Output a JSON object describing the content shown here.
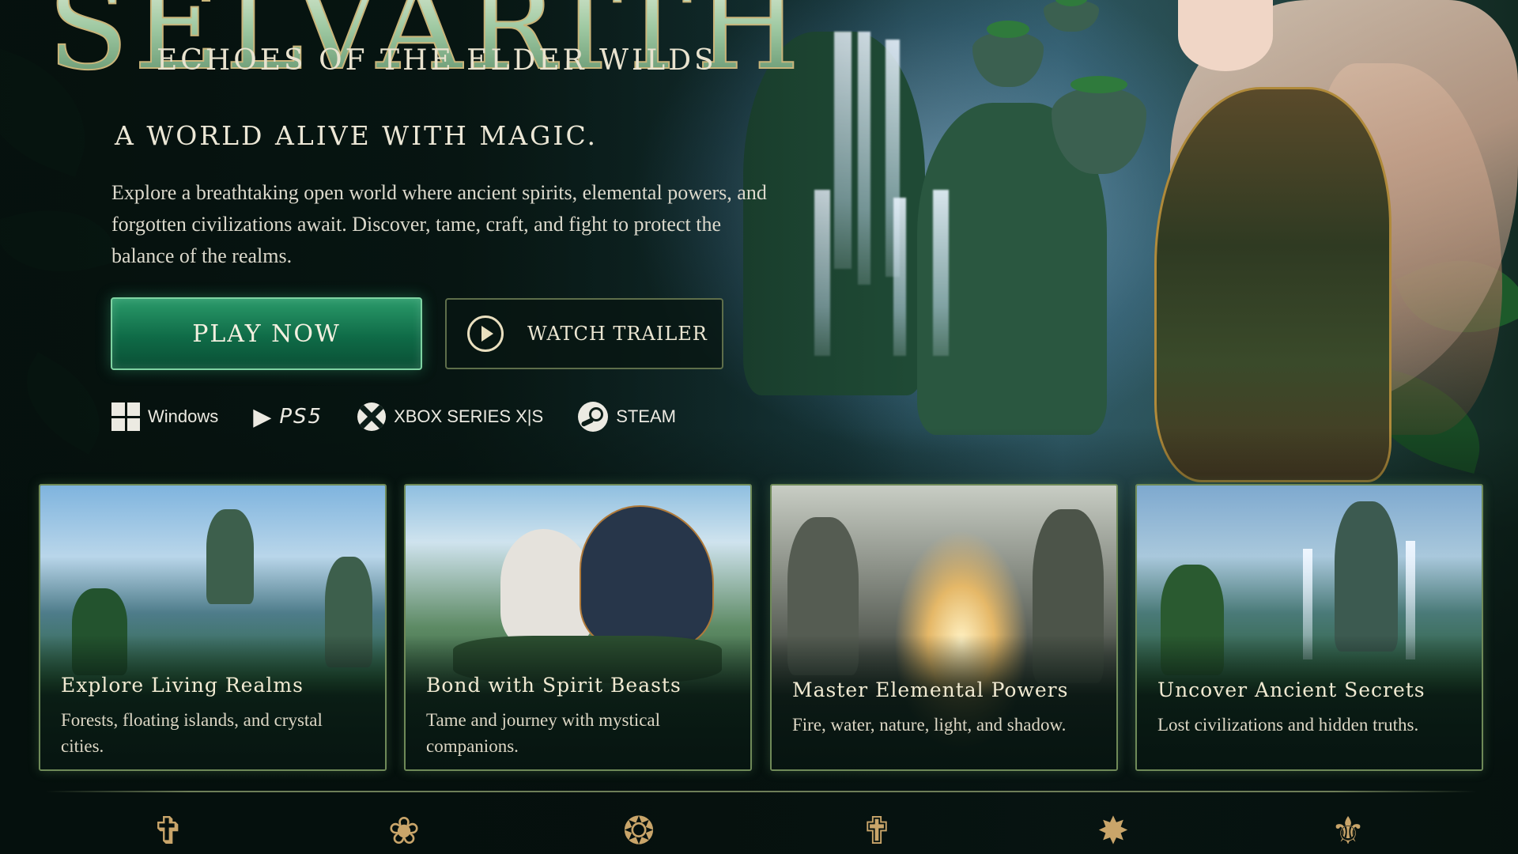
{
  "hero": {
    "logo_text": "SELVARITH",
    "subtitle": "ECHOES OF THE ELDER WILDS",
    "tagline": "A  WORLD ALIVE WITH MAGIC.",
    "description": "Explore a breathtaking open world where ancient spirits, elemental powers, and forgotten civilizations await. Discover, tame, craft, and fight to protect the balance of the realms."
  },
  "buttons": {
    "play_label": "PLAY NOW",
    "trailer_label": "WATCH TRAILER"
  },
  "platforms": {
    "windows": "Windows",
    "ps5": "PS5",
    "xbox": "XBOX SERIES X|S",
    "steam": "STEAM"
  },
  "cards": [
    {
      "title": "Explore Living Realms",
      "desc": "Forests, floating islands, and crystal cities."
    },
    {
      "title": "Bond with Spirit Beasts",
      "desc": "Tame and journey with mystical companions."
    },
    {
      "title": "Master Elemental Powers",
      "desc": "Fire, water, nature, light, and shadow."
    },
    {
      "title": "Uncover Ancient Secrets",
      "desc": "Lost civilizations and hidden truths."
    }
  ],
  "bottom_icons": [
    "bow-emblem-icon",
    "antler-emblem-icon",
    "flame-emblem-icon",
    "staff-emblem-icon",
    "tree-emblem-icon",
    "crest-emblem-icon"
  ],
  "colors": {
    "accent_green": "#1f8a5e",
    "gold": "#c9a56a",
    "background": "#071411"
  }
}
